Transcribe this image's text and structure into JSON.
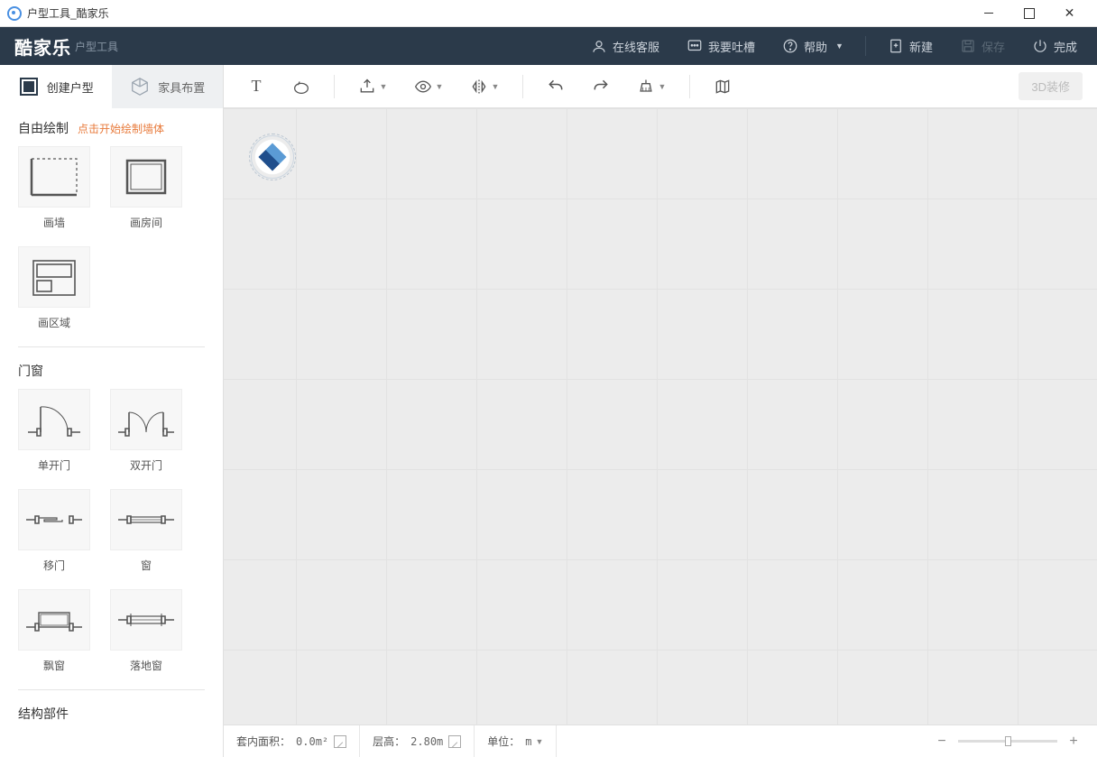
{
  "window": {
    "title": "户型工具_酷家乐"
  },
  "brand": {
    "name": "酷家乐",
    "sub": "户型工具"
  },
  "header": {
    "online_service": "在线客服",
    "feedback": "我要吐槽",
    "help": "帮助",
    "new": "新建",
    "save": "保存",
    "done": "完成"
  },
  "side_tabs": {
    "create": "创建户型",
    "furnish": "家具布置"
  },
  "sections": {
    "free_draw": {
      "title": "自由绘制",
      "hint": "点击开始绘制墙体"
    },
    "door_window": {
      "title": "门窗"
    },
    "structure": {
      "title": "结构部件"
    }
  },
  "tools": {
    "draw_wall": "画墙",
    "draw_room": "画房间",
    "draw_area": "画区域",
    "single_door": "单开门",
    "double_door": "双开门",
    "sliding_door": "移门",
    "window": "窗",
    "bay_window": "飘窗",
    "floor_window": "落地窗"
  },
  "toolbar": {
    "render3d": "3D装修"
  },
  "status": {
    "area_label": "套内面积：",
    "area_value": "0.0m²",
    "height_label": "层高：",
    "height_value": "2.80m",
    "unit_label": "单位：",
    "unit_value": "m"
  }
}
